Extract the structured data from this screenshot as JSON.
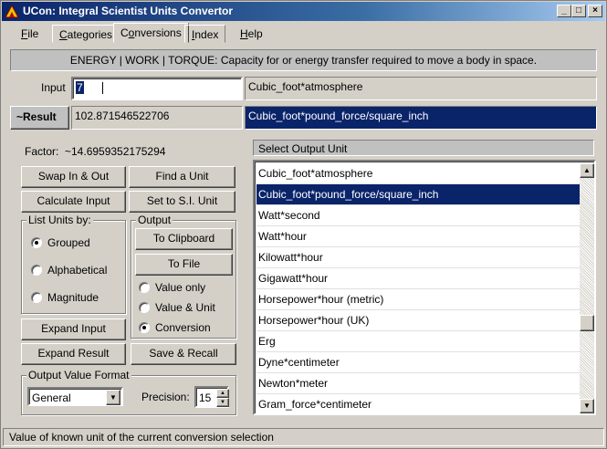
{
  "window": {
    "title": "UCon: Integral Scientist Units Convertor",
    "min_glyph": "_",
    "max_glyph": "□",
    "close_glyph": "×"
  },
  "menu": [
    {
      "label": "File",
      "underline": "F",
      "rest": "ile"
    },
    {
      "label": "Categories",
      "underline": "C",
      "rest": "ategories"
    },
    {
      "label": "Conversions",
      "underline": "o",
      "pre": "C",
      "rest": "nversions"
    },
    {
      "label": "Index",
      "underline": "I",
      "rest": "ndex"
    },
    {
      "label": "Help",
      "underline": "H",
      "rest": "elp"
    }
  ],
  "category": {
    "name": "ENERGY | WORK | TORQUE:",
    "description": "Capacity for or energy transfer required to move a body in space."
  },
  "input": {
    "label": "Input",
    "value": "7",
    "unit": "Cubic_foot*atmosphere"
  },
  "result": {
    "label": "~Result",
    "value": "102.871546522706",
    "unit": "Cubic_foot*pound_force/square_inch"
  },
  "factor": {
    "label": "Factor:",
    "value": "~14.6959352175294"
  },
  "buttons": {
    "swap": "Swap In & Out",
    "find": "Find a Unit",
    "calculate": "Calculate Input",
    "set_si": "Set to S.I. Unit",
    "clipboard": "To Clipboard",
    "file": "To File",
    "expand_input": "Expand Input",
    "expand_result": "Expand Result",
    "save_recall": "Save & Recall"
  },
  "list_units_by": {
    "title": "List Units by:",
    "options": [
      "Grouped",
      "Alphabetical",
      "Magnitude"
    ],
    "selected": "Grouped"
  },
  "output": {
    "title": "Output",
    "options": [
      "Value only",
      "Value & Unit",
      "Conversion"
    ],
    "selected": "Conversion"
  },
  "output_format": {
    "title": "Output Value Format",
    "format": "General",
    "precision_label": "Precision:",
    "precision": "15"
  },
  "output_units": {
    "header": "Select Output Unit",
    "items": [
      "Cubic_foot*atmosphere",
      "Cubic_foot*pound_force/square_inch",
      "Watt*second",
      "Watt*hour",
      "Kilowatt*hour",
      "Gigawatt*hour",
      "Horsepower*hour (metric)",
      "Horsepower*hour (UK)",
      "Erg",
      "Dyne*centimeter",
      "Newton*meter",
      "Gram_force*centimeter"
    ],
    "selected_index": 1
  },
  "status": "Value of known unit of the current conversion selection",
  "colors": {
    "selection": "#0a246a",
    "face": "#d4d0c8"
  }
}
